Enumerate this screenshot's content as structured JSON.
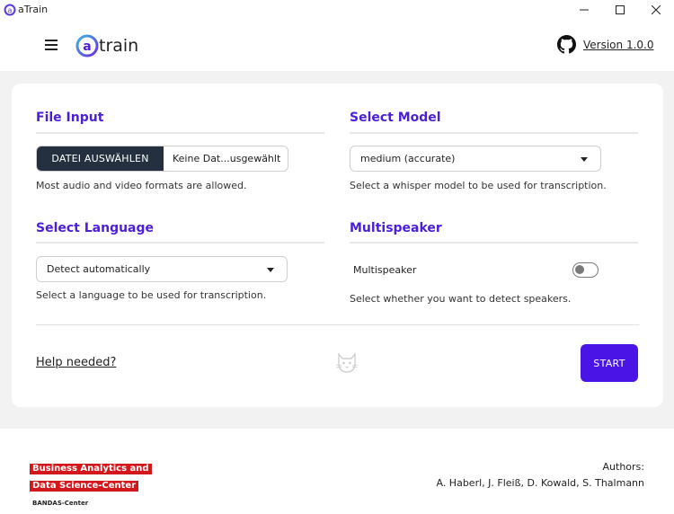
{
  "window": {
    "title": "aTrain"
  },
  "header": {
    "logo_text": "atrain",
    "version_label": "Version 1.0.0"
  },
  "file_input": {
    "title": "File Input",
    "button_label": "DATEI AUSWÄHLEN",
    "file_name": "Keine Dat...usgewählt",
    "hint": "Most audio and video formats are allowed."
  },
  "select_model": {
    "title": "Select Model",
    "selected": "medium (accurate)",
    "hint": "Select a whisper model to be used for transcription."
  },
  "select_language": {
    "title": "Select Language",
    "selected": "Detect automatically",
    "hint": "Select a language to be used for transcription."
  },
  "multispeaker": {
    "title": "Multispeaker",
    "toggle_label": "Multispeaker",
    "enabled": false,
    "hint": "Select whether you want to detect speakers."
  },
  "actions": {
    "help_label": "Help needed?",
    "start_label": "START"
  },
  "footer": {
    "brand_line1": "Business Analytics and",
    "brand_line2": "Data Science-Center",
    "brand_line3": "BANDAS-Center",
    "authors_title": "Authors:",
    "authors_names": "A. Haberl, J. Fleiß, D. Kowald, S. Thalmann"
  },
  "colors": {
    "accent": "#4a14e6",
    "title": "#4b1fd6",
    "file_button": "#24303f",
    "brand_red": "#d2181c"
  },
  "icons": [
    "atrain-logo-icon",
    "minimize-icon",
    "maximize-icon",
    "close-icon",
    "hamburger-menu-icon",
    "github-icon",
    "chevron-down-icon",
    "cat-icon"
  ]
}
